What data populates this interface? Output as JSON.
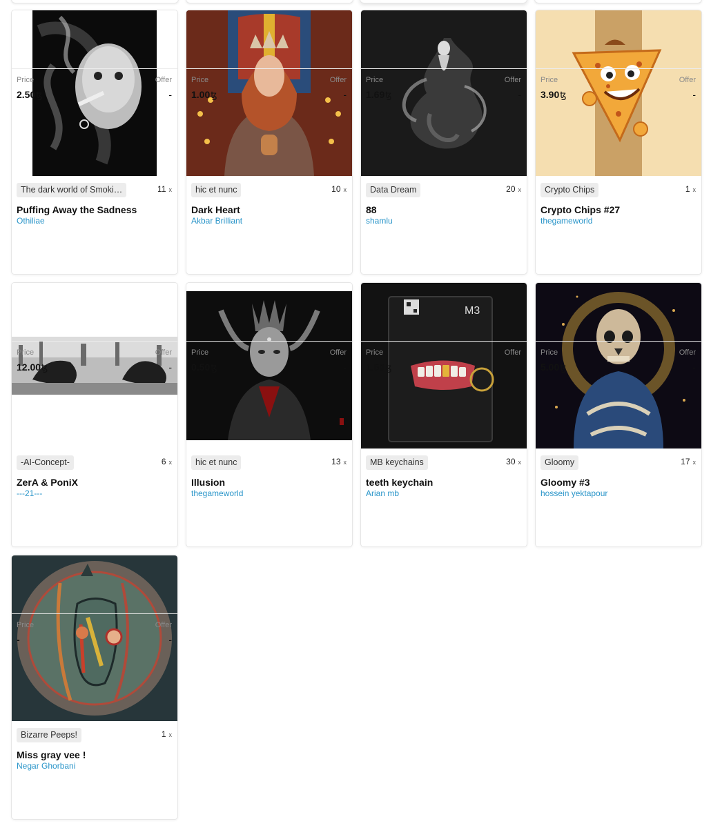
{
  "labels": {
    "price": "Price",
    "offer": "Offer",
    "editions_suffix": "x",
    "currency": "ꜩ"
  },
  "cards": [
    {
      "collection": "The dark world of Smoki…",
      "editions": "11",
      "title": "Puffing Away the Sadness",
      "artist": "Othiliae",
      "price": "2.50",
      "offer": "-",
      "image": "smoking-portrait"
    },
    {
      "collection": "hic et nunc",
      "editions": "10",
      "title": "Dark Heart",
      "artist": "Akbar Brilliant",
      "price": "1.00",
      "offer": "-",
      "image": "priestess-cathedral"
    },
    {
      "collection": "Data Dream",
      "editions": "20",
      "title": "88",
      "artist": "shamlu",
      "price": "1.69",
      "offer": "-",
      "image": "smoke-figure"
    },
    {
      "collection": "Crypto Chips",
      "editions": "1",
      "title": "Crypto Chips #27",
      "artist": "thegameworld",
      "price": "3.90",
      "offer": "-",
      "image": "chip-character"
    },
    {
      "collection": "-AI-Concept-",
      "editions": "6",
      "title": "ZerA & PoniX",
      "artist": "---21---",
      "price": "12.00",
      "offer": "-",
      "image": "panorama-creatures"
    },
    {
      "collection": "hic et nunc",
      "editions": "13",
      "title": "Illusion",
      "artist": "thegameworld",
      "price": "0.50",
      "offer": "-",
      "image": "horned-demon"
    },
    {
      "collection": "MB keychains",
      "editions": "30",
      "title": "teeth keychain",
      "artist": "Arian mb",
      "price": "1.50",
      "offer": "-",
      "image": "teeth-keychain"
    },
    {
      "collection": "Gloomy",
      "editions": "17",
      "title": "Gloomy #3",
      "artist": "hossein yektapour",
      "price": "5.00",
      "offer": "-",
      "image": "skull-figure"
    },
    {
      "collection": "Bizarre Peeps!",
      "editions": "1",
      "title": "Miss gray vee !",
      "artist": "Negar Ghorbani",
      "price": "-",
      "offer": "-",
      "image": "abstract-face"
    }
  ]
}
